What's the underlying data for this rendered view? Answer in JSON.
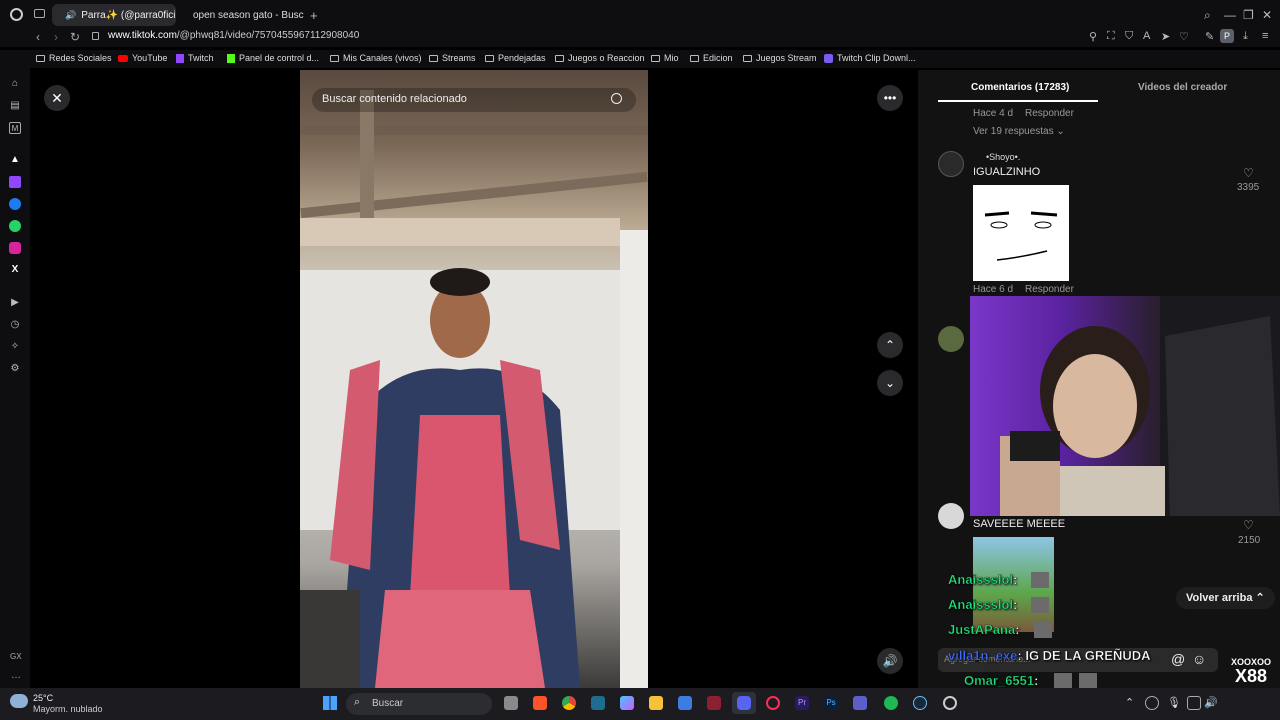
{
  "tabs": [
    {
      "label": "Parra✨ (@parra0fici",
      "active": true
    },
    {
      "label": "open season gato - Busca",
      "active": false
    }
  ],
  "address": {
    "host": "www.tiktok.com",
    "path": "/@phwq81/video/7570455967112908040"
  },
  "bookmarks": [
    "Redes Sociales",
    "YouTube",
    "Twitch",
    "Panel de control d...",
    "Mis Canales (vivos)",
    "Streams",
    "Pendejadas",
    "Juegos o Reaccion",
    "Mio",
    "Edicion",
    "Juegos Stream",
    "Twitch Clip Downl..."
  ],
  "video": {
    "search_placeholder": "Buscar contenido relacionado"
  },
  "panel": {
    "tab_comments": "Comentarios (17283)",
    "tab_creator": "Videos del creador",
    "top_meta_time": "Hace 4 d",
    "reply": "Responder",
    "view_replies": "Ver 19 respuestas",
    "c1": {
      "tag": "•Shoyo•.",
      "user": "IGUALZINHO",
      "likes": "3395",
      "time": "Hace 6 d"
    },
    "c2": {
      "user": "SAVEEEE MEEEE",
      "likes": "2150"
    },
    "back_to_top": "Volver arriba",
    "add_comment": "Agregar comentario..."
  },
  "chat": [
    {
      "user": "Anaissslol",
      "sep": ":",
      "color": "#22e07a"
    },
    {
      "user": "Anaissslol",
      "sep": ":",
      "color": "#22e07a"
    },
    {
      "user": "JustAPana",
      "sep": ":",
      "color": "#22e07a"
    },
    {
      "user": "villa1n_exe",
      "sep": ": IG DE LA GREÑUDA",
      "color": "#3d6cff"
    },
    {
      "user": "Omar_6551",
      "sep": ":",
      "color": "#22e07a"
    }
  ],
  "overlay_badge": {
    "small": "XOOXOO",
    "big": "X88"
  },
  "weather": {
    "temp": "25°C",
    "desc": "Mayorm. nublado"
  },
  "taskbar": {
    "search": "Buscar"
  },
  "sidebar_bottom": "GX"
}
